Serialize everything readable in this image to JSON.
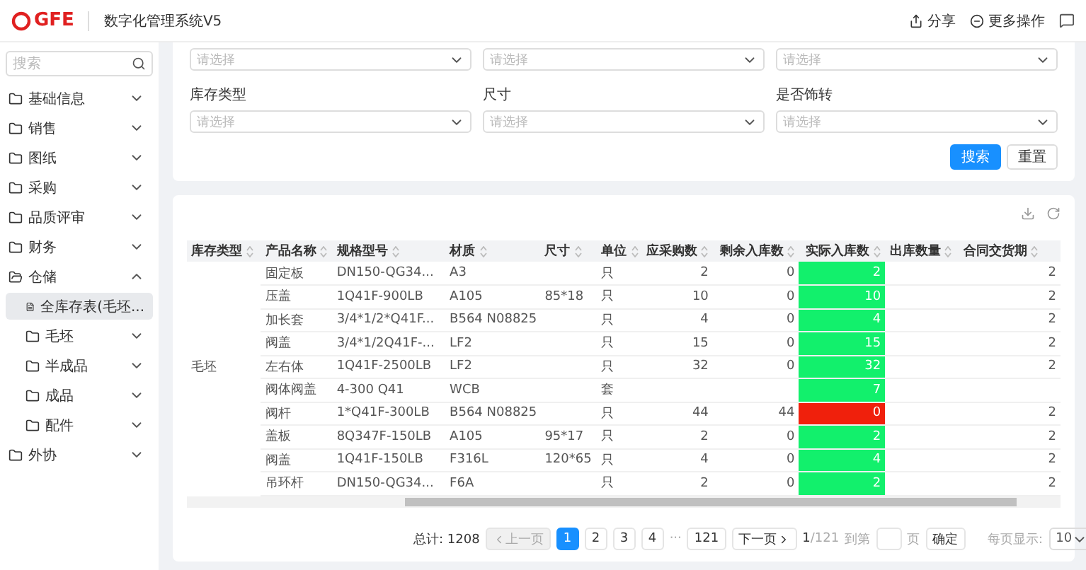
{
  "header": {
    "logo": "GFE",
    "title": "数字化管理系统V5",
    "actions": [
      {
        "label": "分享",
        "kind": "share"
      },
      {
        "label": "更多操作",
        "kind": "more"
      }
    ]
  },
  "sidebar": {
    "search": {
      "placeholder": "搜索"
    },
    "items": [
      {
        "label": "基础信息",
        "expanded": false,
        "selected": false
      },
      {
        "label": "销售",
        "expanded": false,
        "selected": false
      },
      {
        "label": "图纸",
        "expanded": false,
        "selected": false
      },
      {
        "label": "采购",
        "expanded": false,
        "selected": false
      },
      {
        "label": "品质评审",
        "expanded": false,
        "selected": false
      },
      {
        "label": "财务",
        "expanded": false,
        "selected": false
      },
      {
        "label": "仓储",
        "expanded": true,
        "selected": false,
        "children": [
          {
            "label": "全库存表(毛坯...",
            "kind": "page",
            "selected": true
          },
          {
            "label": "毛坯",
            "kind": "folder",
            "expanded": false,
            "selected": false
          },
          {
            "label": "半成品",
            "kind": "folder",
            "expanded": false,
            "selected": false
          },
          {
            "label": "成品",
            "kind": "folder",
            "expanded": false,
            "selected": false
          },
          {
            "label": "配件",
            "kind": "folder",
            "expanded": false,
            "selected": false
          }
        ]
      },
      {
        "label": "外协",
        "expanded": false,
        "selected": false
      }
    ]
  },
  "filters": {
    "top_row": [
      {
        "placeholder": "请选择"
      },
      {
        "placeholder": "请选择"
      },
      {
        "placeholder": "请选择"
      }
    ],
    "fields": [
      {
        "label": "库存类型",
        "placeholder": "请选择"
      },
      {
        "label": "尺寸",
        "placeholder": "请选择"
      },
      {
        "label": "是否饰转",
        "placeholder": "请选择"
      }
    ],
    "buttons": [
      {
        "label": "搜索",
        "primary": true
      },
      {
        "label": "重置",
        "primary": false
      }
    ]
  },
  "table": {
    "columns": [
      "库存类型",
      "产品名称",
      "规格型号",
      "材质",
      "尺寸",
      "单位",
      "应采购数",
      "剩余入库数",
      "实际入库数",
      "出库数量",
      "合同交货期"
    ],
    "rows": [
      {
        "cells": [
          "",
          "固定板",
          "DN150-QG34...",
          "A3",
          "",
          "只",
          "2",
          "0",
          "2",
          "",
          "",
          "2"
        ],
        "color": "#12f06c"
      },
      {
        "cells": [
          "",
          "压盖",
          "1Q41F-900LB",
          "A105",
          "85*18",
          "只",
          "10",
          "0",
          "10",
          "",
          "",
          "2"
        ],
        "color": "#12f06c"
      },
      {
        "cells": [
          "",
          "加长套",
          "3/4*1/2*Q41F...",
          "B564 N08825",
          "",
          "只",
          "4",
          "0",
          "4",
          "",
          "",
          "2"
        ],
        "color": "#12f06c"
      },
      {
        "cells": [
          "",
          "阀盖",
          "3/4*1/2Q41F-...",
          "LF2",
          "",
          "只",
          "15",
          "0",
          "15",
          "",
          "",
          "2"
        ],
        "color": "#12f06c"
      },
      {
        "cells": [
          "毛坯",
          "左右体",
          "1Q41F-2500LB",
          "LF2",
          "",
          "只",
          "32",
          "0",
          "32",
          "",
          "",
          "2"
        ],
        "color": "#12f06c"
      },
      {
        "cells": [
          "",
          "阀体阀盖",
          "4-300 Q41",
          "WCB",
          "",
          "套",
          "",
          "",
          "7",
          "",
          "",
          ""
        ],
        "color": "#12f06c"
      },
      {
        "cells": [
          "",
          "阀杆",
          "1*Q41F-300LB",
          "B564 N08825",
          "",
          "只",
          "44",
          "44",
          "0",
          "",
          "",
          "2"
        ],
        "color": "#f0200c"
      },
      {
        "cells": [
          "",
          "盖板",
          "8Q347F-150LB",
          "A105",
          "95*17",
          "只",
          "2",
          "0",
          "2",
          "",
          "",
          "2"
        ],
        "color": "#12f06c"
      },
      {
        "cells": [
          "",
          "阀盖",
          "1Q41F-150LB",
          "F316L",
          "120*65",
          "只",
          "4",
          "0",
          "4",
          "",
          "",
          "2"
        ],
        "color": "#12f06c"
      },
      {
        "cells": [
          "",
          "吊环杆",
          "DN150-QG34...",
          "F6A",
          "",
          "只",
          "2",
          "0",
          "2",
          "",
          "",
          "2"
        ],
        "color": "#12f06c"
      }
    ]
  },
  "pagination": {
    "total": "总计: 1208",
    "prev": "上一页",
    "prev_disabled": true,
    "pages": [
      {
        "label": "1",
        "selected": true
      },
      {
        "label": "2",
        "selected": false
      },
      {
        "label": "3",
        "selected": false
      },
      {
        "label": "4",
        "selected": false
      }
    ],
    "ellipsis": "···",
    "last": "121",
    "next": "下一页",
    "current": "1",
    "count": "/121",
    "goto": "到第",
    "goto_unit": "页",
    "confirm": "确定",
    "page_size_label": "每页显示:",
    "page_size": "10"
  }
}
